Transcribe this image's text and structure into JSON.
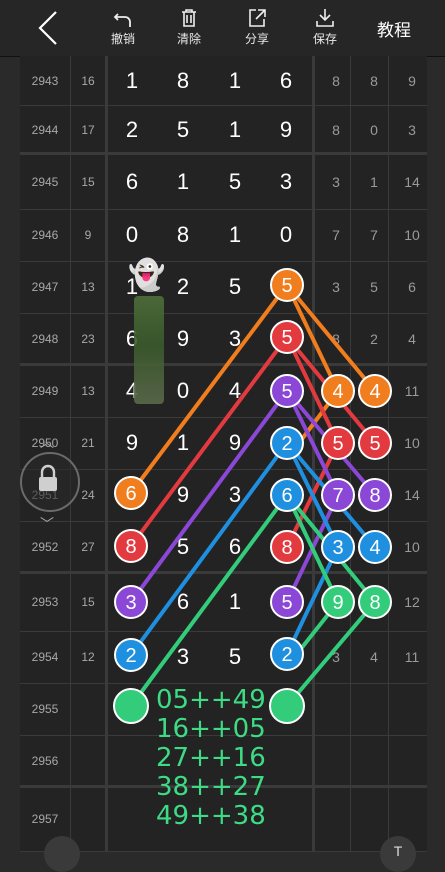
{
  "toolbar": {
    "undo_label": "撤销",
    "clear_label": "清除",
    "share_label": "分享",
    "save_label": "保存",
    "tutorial_label": "教程"
  },
  "rows": [
    {
      "issue": "2943",
      "sum": "16",
      "d": [
        "1",
        "8",
        "1",
        "6"
      ],
      "s": [
        "8",
        "8",
        "9"
      ]
    },
    {
      "issue": "2944",
      "sum": "17",
      "d": [
        "2",
        "5",
        "1",
        "9"
      ],
      "s": [
        "8",
        "0",
        "3"
      ]
    },
    {
      "issue": "2945",
      "sum": "15",
      "d": [
        "6",
        "1",
        "5",
        "3"
      ],
      "s": [
        "3",
        "1",
        "14"
      ]
    },
    {
      "issue": "2946",
      "sum": "9",
      "d": [
        "0",
        "8",
        "1",
        "0"
      ],
      "s": [
        "7",
        "7",
        "10"
      ]
    },
    {
      "issue": "2947",
      "sum": "13",
      "d": [
        "1",
        "2",
        "5",
        ""
      ],
      "s": [
        "3",
        "5",
        "6"
      ]
    },
    {
      "issue": "2948",
      "sum": "23",
      "d": [
        "6",
        "9",
        "3",
        ""
      ],
      "s": [
        "8",
        "2",
        "4"
      ]
    },
    {
      "issue": "2949",
      "sum": "13",
      "d": [
        "4",
        "0",
        "4",
        ""
      ],
      "s": [
        "",
        "",
        "11"
      ]
    },
    {
      "issue": "2950",
      "sum": "21",
      "d": [
        "9",
        "1",
        "9",
        ""
      ],
      "s": [
        "",
        "",
        "10"
      ]
    },
    {
      "issue": "2951",
      "sum": "24",
      "d": [
        "",
        "9",
        "3",
        ""
      ],
      "s": [
        "",
        "",
        "14"
      ]
    },
    {
      "issue": "2952",
      "sum": "27",
      "d": [
        "",
        "5",
        "6",
        ""
      ],
      "s": [
        "",
        "",
        "10"
      ]
    },
    {
      "issue": "2953",
      "sum": "15",
      "d": [
        "",
        "6",
        "1",
        ""
      ],
      "s": [
        "",
        "",
        "12"
      ]
    },
    {
      "issue": "2954",
      "sum": "12",
      "d": [
        "",
        "3",
        "5",
        ""
      ],
      "s": [
        "3",
        "4",
        "11"
      ]
    },
    {
      "issue": "2955",
      "sum": "",
      "d": [
        "",
        "",
        "",
        ""
      ],
      "s": [
        "",
        "",
        ""
      ]
    },
    {
      "issue": "2956",
      "sum": "",
      "d": [
        "",
        "",
        "",
        ""
      ],
      "s": [
        "",
        "",
        ""
      ]
    },
    {
      "issue": "2957",
      "sum": "",
      "d": [
        "",
        "",
        "",
        ""
      ],
      "s": [
        "",
        "",
        ""
      ]
    }
  ],
  "annotations": [
    "05++49",
    "16++05",
    "27++16",
    "38++27",
    "49++38"
  ],
  "emoji": "👻",
  "lock_icon": "lock-icon",
  "right_fab_label": "T",
  "colors": {
    "orange": "#f07d1e",
    "red": "#e23a3f",
    "purple": "#8b47d6",
    "blue": "#1f8fe0",
    "green": "#33cc7a",
    "background": "#262626"
  },
  "circles": [
    {
      "n": "5",
      "color": "orange"
    },
    {
      "n": "5",
      "color": "red"
    },
    {
      "n": "5",
      "color": "purple"
    },
    {
      "n": "2",
      "color": "blue"
    },
    {
      "n": "6",
      "color": "blue"
    },
    {
      "n": "8",
      "color": "red"
    },
    {
      "n": "5",
      "color": "purple"
    },
    {
      "n": "2",
      "color": "blue"
    },
    {
      "n": "6",
      "color": "orange"
    },
    {
      "n": "8",
      "color": "red"
    },
    {
      "n": "3",
      "color": "purple"
    },
    {
      "n": "2",
      "color": "blue"
    },
    {
      "n": "4",
      "color": "orange"
    },
    {
      "n": "4",
      "color": "orange"
    },
    {
      "n": "5",
      "color": "red"
    },
    {
      "n": "5",
      "color": "red"
    },
    {
      "n": "7",
      "color": "purple"
    },
    {
      "n": "8",
      "color": "purple"
    },
    {
      "n": "3",
      "color": "blue"
    },
    {
      "n": "4",
      "color": "blue"
    },
    {
      "n": "9",
      "color": "green"
    },
    {
      "n": "8",
      "color": "green"
    },
    {
      "n": "",
      "color": "green"
    },
    {
      "n": "",
      "color": "green"
    }
  ]
}
